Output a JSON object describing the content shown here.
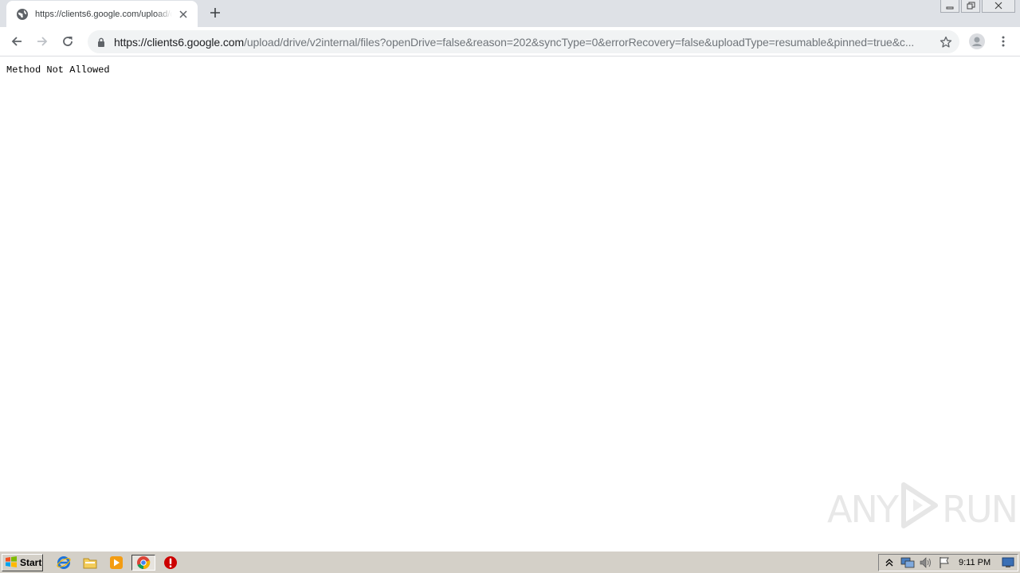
{
  "tab": {
    "title": "https://clients6.google.com/upload/drive/v2internal/files",
    "favicon": "globe-icon",
    "close_icon": "close-icon"
  },
  "new_tab_icon": "plus-icon",
  "window_controls": [
    "minimize-icon",
    "restore-icon",
    "close-icon"
  ],
  "toolbar": {
    "back_icon": "arrow-left-icon",
    "forward_icon": "arrow-right-icon",
    "reload_icon": "reload-icon",
    "lock_icon": "lock-icon",
    "url_host": "https://clients6.google.com",
    "url_path": "/upload/drive/v2internal/files?openDrive=false&reason=202&syncType=0&errorRecovery=false&uploadType=resumable&pinned=true&c...",
    "bookmark_icon": "star-icon",
    "profile_icon": "avatar-icon",
    "menu_icon": "kebab-menu-icon"
  },
  "page": {
    "body_text": "Method Not Allowed"
  },
  "watermark": {
    "left": "ANY",
    "right": "RUN"
  },
  "taskbar": {
    "start_label": "Start",
    "pinned": [
      "internet-explorer-icon",
      "folder-icon",
      "media-player-icon",
      "chrome-icon",
      "stop-icon"
    ],
    "tray": [
      "show-hidden-icon",
      "network-icon",
      "volume-icon",
      "flag-icon"
    ],
    "clock": "9:11 PM"
  },
  "colors": {
    "tab_strip": "#dee1e6",
    "omnibox": "#f1f3f4",
    "taskbar": "#d4d0c8"
  }
}
